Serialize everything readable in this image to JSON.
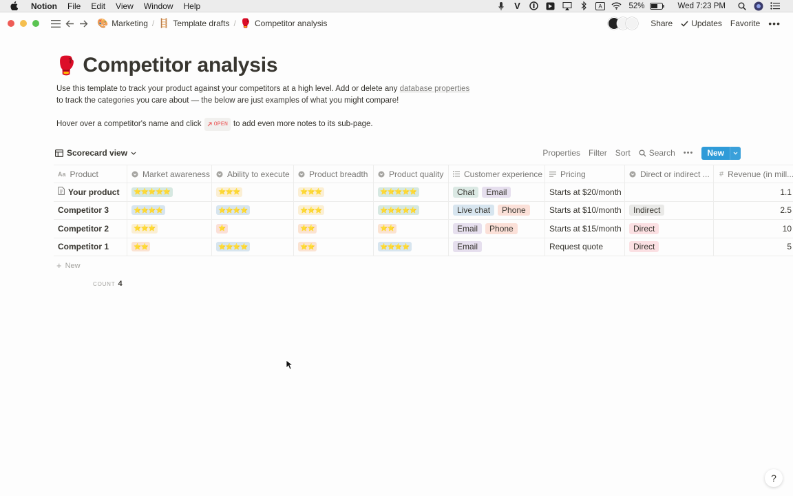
{
  "menubar": {
    "app": "Notion",
    "items": [
      "File",
      "Edit",
      "View",
      "Window",
      "Help"
    ],
    "battery": "52%",
    "clock": "Wed 7:23 PM"
  },
  "toolbar": {
    "breadcrumbs": [
      {
        "icon": "palette-icon",
        "label": "Marketing"
      },
      {
        "icon": "ladder-icon",
        "label": "Template drafts"
      },
      {
        "icon": "boxing-glove-icon",
        "label": "Competitor analysis"
      }
    ],
    "share": "Share",
    "updates": "Updates",
    "favorite": "Favorite"
  },
  "page": {
    "title": "Competitor analysis",
    "desc_part1": "Use this template to track your product against your competitors at a high level. Add or delete any ",
    "desc_link": "database properties",
    "desc_part2": "to track the categories you care about — the below are just examples of what you might compare!",
    "hover_part1": "Hover over a competitor's name and click",
    "open_chip": "OPEN",
    "hover_part2": "to add even more notes to its sub-page."
  },
  "viewbar": {
    "view_name": "Scorecard view",
    "properties": "Properties",
    "filter": "Filter",
    "sort": "Sort",
    "search": "Search",
    "new": "New"
  },
  "table": {
    "columns": [
      "Product",
      "Market awareness",
      "Ability to execute",
      "Product breadth",
      "Product quality",
      "Customer experience",
      "Pricing",
      "Direct or indirect ...",
      "Revenue (in mill..."
    ],
    "rows": [
      {
        "product": "Your product",
        "market_awareness": "⭐⭐⭐⭐⭐",
        "ability": "⭐⭐⭐",
        "breadth": "⭐⭐⭐",
        "quality": "⭐⭐⭐⭐⭐",
        "cx": [
          "Chat",
          "Email"
        ],
        "pricing": "Starts at $20/month",
        "direct": "",
        "revenue": "1.1"
      },
      {
        "product": "Competitor 3",
        "market_awareness": "⭐⭐⭐⭐",
        "ability": "⭐⭐⭐⭐",
        "breadth": "⭐⭐⭐",
        "quality": "⭐⭐⭐⭐⭐",
        "cx": [
          "Live chat",
          "Phone"
        ],
        "pricing": "Starts at $10/month",
        "direct": "Indirect",
        "revenue": "2.5"
      },
      {
        "product": "Competitor 2",
        "market_awareness": "⭐⭐⭐",
        "ability": "⭐",
        "breadth": "⭐⭐",
        "quality": "⭐⭐",
        "cx": [
          "Email",
          "Phone"
        ],
        "pricing": "Starts at $15/month",
        "direct": "Direct",
        "revenue": "10"
      },
      {
        "product": "Competitor 1",
        "market_awareness": "⭐⭐",
        "ability": "⭐⭐⭐⭐",
        "breadth": "⭐⭐",
        "quality": "⭐⭐⭐⭐",
        "cx": [
          "Email"
        ],
        "pricing": "Request quote",
        "direct": "Direct",
        "revenue": "5"
      }
    ],
    "new_row": "New",
    "count_label": "COUNT",
    "count_value": "4"
  },
  "help": "?"
}
